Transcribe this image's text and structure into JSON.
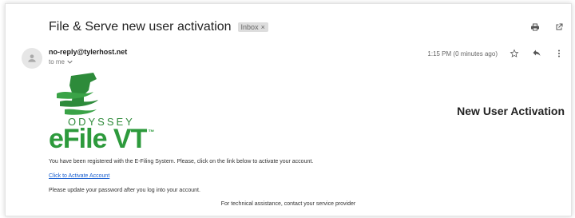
{
  "email": {
    "subject": "File & Serve new user activation",
    "label": "Inbox",
    "label_close": "×",
    "sender": "no-reply@tylerhost.net",
    "recipient": "to me",
    "timestamp": "1:15 PM (0 minutes ago)"
  },
  "icons": {
    "print": "print-icon",
    "open_new_window": "open-in-new-window-icon",
    "star": "star-icon",
    "reply": "reply-icon",
    "more": "more-vert-icon",
    "avatar": "person-icon",
    "recipient_dropdown": "chevron-down-icon"
  },
  "body": {
    "logo_text_top": "ODYSSEY",
    "logo_text_main": "eFile VT",
    "logo_tm": "™",
    "heading": "New User Activation",
    "paragraph_1": "You have been registered with the E-Filing System. Please, click on the link below to activate your account.",
    "activation_link": "Click to Activate Account",
    "paragraph_2": "Please update your password after you log into your account.",
    "footer": "For technical assistance, contact your service provider"
  },
  "colors": {
    "brand_green": "#2d9a3c",
    "link_blue": "#1a5fd0"
  }
}
